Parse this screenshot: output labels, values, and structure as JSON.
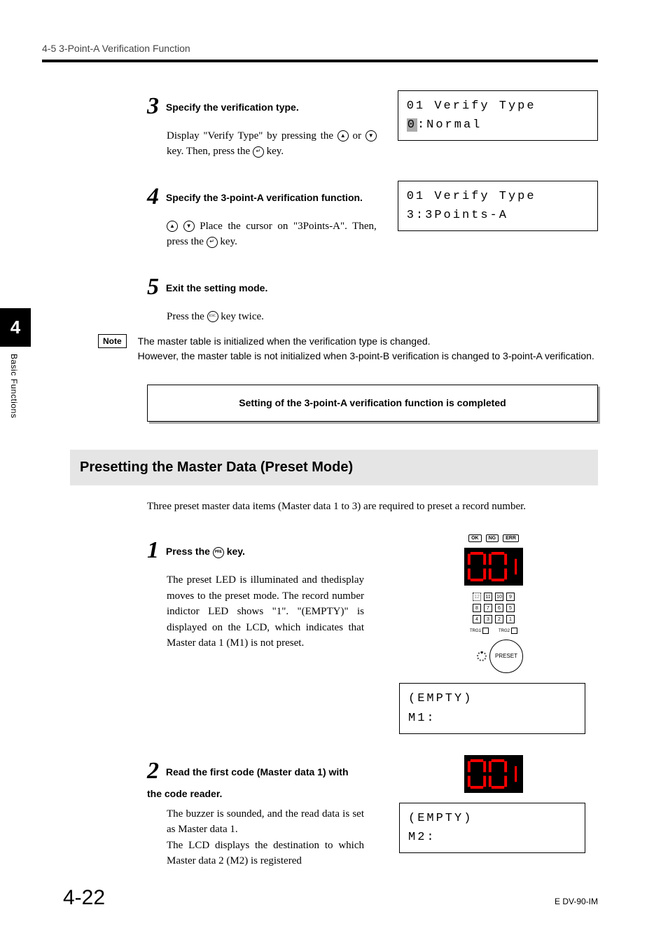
{
  "header": "4-5  3-Point-A Verification Function",
  "side": {
    "chapter": "4",
    "label": "Basic Functions"
  },
  "steps": {
    "s3": {
      "num": "3",
      "title": "Specify the verification type.",
      "body_1": "Display \"Verify Type\" by pressing the ",
      "body_2": " or ",
      "body_3": " key. Then, press the ",
      "body_4": " key.",
      "lcd_l1": "01 Verify Type",
      "lcd_l2_cursor": "0",
      "lcd_l2_rest": ":Normal"
    },
    "s4": {
      "num": "4",
      "title": "Specify the 3-point-A verification function.",
      "body_1": " Place the cursor on \"3Points-A\". Then, press the ",
      "body_2": " key.",
      "lcd_l1": "01 Verify Type",
      "lcd_l2": "3:3Points-A"
    },
    "s5": {
      "num": "5",
      "title": "Exit the setting mode.",
      "body_1": "Press the ",
      "body_2": " key twice.",
      "esc": "ESC"
    }
  },
  "note": {
    "label": "Note",
    "text": "The master table is initialized when the verification type is changed.\nHowever, the master table is not initialized when 3-point-B verification is changed to 3-point-A verification."
  },
  "completion": "Setting of the 3-point-A verification function is completed",
  "section2": {
    "heading": "Presetting the Master Data (Preset Mode)",
    "intro": "Three preset master data items (Master data 1 to 3) are required to preset a record number."
  },
  "preset": {
    "s1": {
      "num": "1",
      "title_a": "Press the ",
      "title_b": " key.",
      "pre_label": "PRE",
      "body": "The preset LED is illuminated and thedisplay moves to the preset mode. The record number indictor LED shows \"1\". \"(EMPTY)\" is displayed on the LCD, which indicates that Master data 1 (M1) is not preset.",
      "badges": {
        "ok": "OK",
        "ng": "NG",
        "err": "ERR"
      },
      "grid": [
        "12",
        "11",
        "10",
        "9",
        "8",
        "7",
        "6",
        "5",
        "4",
        "3",
        "2",
        "1"
      ],
      "trg1": "TRG1",
      "trg2": "TRG2",
      "preset_label": "PRESET",
      "lcd_l1": "(EMPTY)",
      "lcd_l2": "M1:"
    },
    "s2": {
      "num": "2",
      "title": "Read the first code (Master data 1) with the code reader.",
      "body": "The buzzer is sounded, and the read data is set as Master data 1.\nThe LCD displays the destination to which Master data 2 (M2) is registered",
      "lcd_l1": "(EMPTY)",
      "lcd_l2": "M2:"
    }
  },
  "footer": {
    "page": "4-22",
    "ref": "E DV-90-IM"
  }
}
